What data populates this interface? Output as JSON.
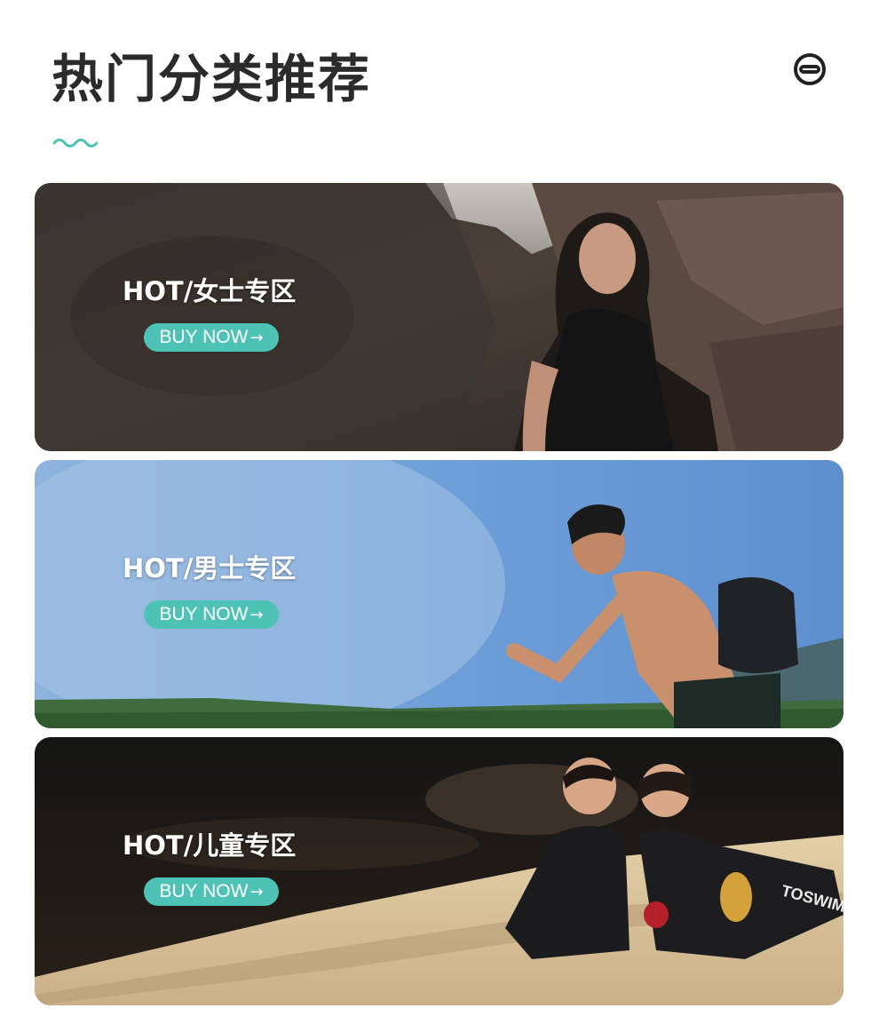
{
  "header": {
    "title": "热门分类推荐",
    "wave_icon": "wave-icon",
    "goggles_icon": "swim-goggles-icon"
  },
  "banners": [
    {
      "title": "HOT/女士专区",
      "button_label": "BUY NOW",
      "button_icon": "arrow-right-icon"
    },
    {
      "title": "HOT/男士专区",
      "button_label": "BUY NOW",
      "button_icon": "arrow-right-icon"
    },
    {
      "title": "HOT/儿童专区",
      "button_label": "BUY NOW",
      "button_icon": "arrow-right-icon",
      "bag_text": "TOSWIM",
      "suit_text": "TOSWIM"
    }
  ],
  "colors": {
    "accent": "#4ec3b5",
    "title": "#2b2b2b"
  }
}
